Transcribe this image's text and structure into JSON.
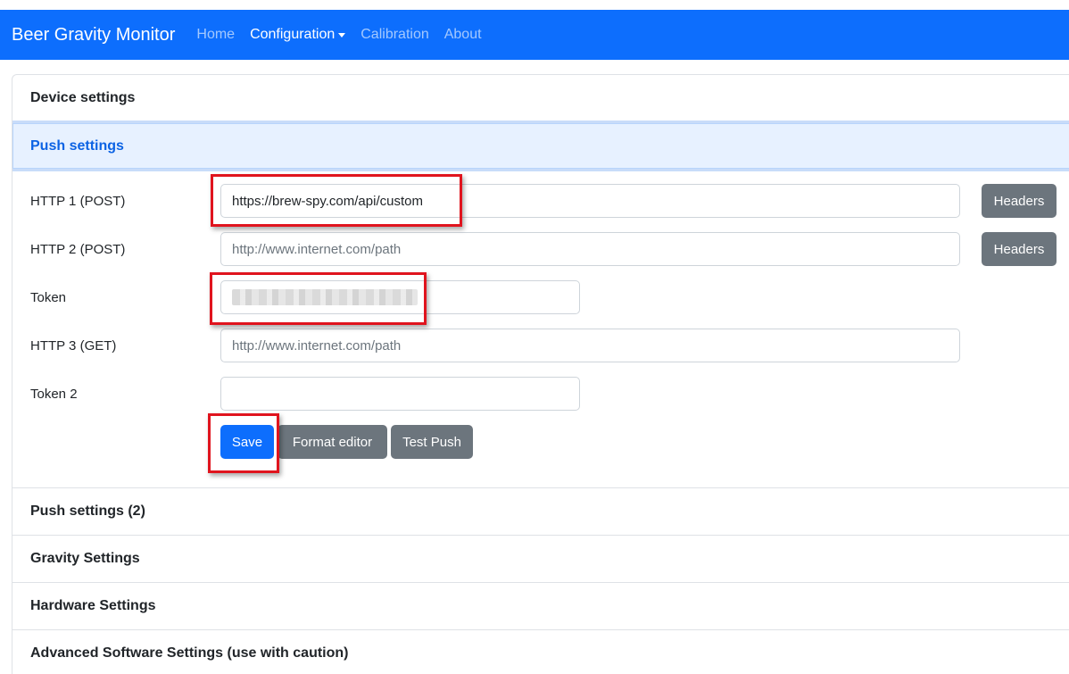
{
  "navbar": {
    "brand": "Beer Gravity Monitor",
    "links": [
      {
        "label": "Home"
      },
      {
        "label": "Configuration"
      },
      {
        "label": "Calibration"
      },
      {
        "label": "About"
      }
    ],
    "accent_color": "#0d6efd"
  },
  "accordion": {
    "device": "Device settings",
    "push": "Push settings",
    "push2": "Push settings (2)",
    "gravity": "Gravity Settings",
    "hardware": "Hardware Settings",
    "advanced": "Advanced Software Settings (use with caution)"
  },
  "push_form": {
    "http1": {
      "label": "HTTP 1 (POST)",
      "value": "https://brew-spy.com/api/custom",
      "headers_button": "Headers"
    },
    "http2": {
      "label": "HTTP 2 (POST)",
      "placeholder": "http://www.internet.com/path",
      "headers_button": "Headers"
    },
    "token": {
      "label": "Token"
    },
    "http3": {
      "label": "HTTP 3 (GET)",
      "placeholder": "http://www.internet.com/path"
    },
    "token2": {
      "label": "Token 2",
      "value": ""
    },
    "buttons": {
      "save": "Save",
      "format_editor": "Format editor",
      "test_push": "Test Push"
    }
  },
  "highlight_color": "#e0141e"
}
